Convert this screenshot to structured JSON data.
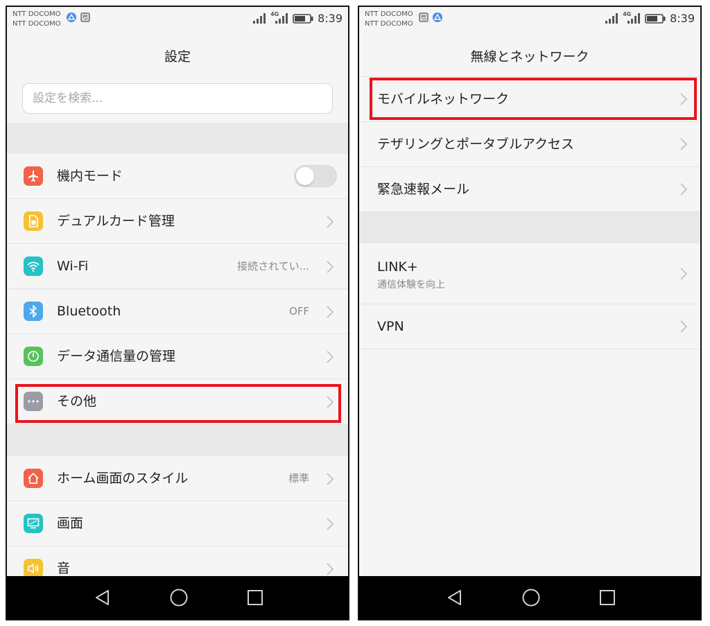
{
  "status_bar": {
    "carrier_line1": "NTT DOCOMO",
    "carrier_line2": "NTT DOCOMO",
    "network": "4G",
    "time": "8:39"
  },
  "left": {
    "title": "設定",
    "search": {
      "placeholder": "設定を検索..."
    },
    "items": [
      {
        "label": "機内モード",
        "icon": "airplane-icon",
        "color": "#f0624a",
        "toggle": "off"
      },
      {
        "label": "デュアルカード管理",
        "icon": "sim-card-icon",
        "color": "#f7c232"
      },
      {
        "label": "Wi-Fi",
        "icon": "wifi-icon",
        "color": "#25c3c4",
        "value": "接続されてい..."
      },
      {
        "label": "Bluetooth",
        "icon": "bluetooth-icon",
        "color": "#4da8ec",
        "value": "OFF"
      },
      {
        "label": "データ通信量の管理",
        "icon": "data-usage-icon",
        "color": "#58c35c"
      },
      {
        "label": "その他",
        "icon": "more-icon",
        "color": "#9a9ca6"
      },
      {
        "label": "ホーム画面のスタイル",
        "icon": "home-icon",
        "color": "#f0624a",
        "value": "標準"
      },
      {
        "label": "画面",
        "icon": "display-icon",
        "color": "#25c3c4"
      },
      {
        "label": "音",
        "icon": "sound-icon",
        "color": "#f7c232"
      }
    ]
  },
  "right": {
    "title": "無線とネットワーク",
    "items": [
      {
        "label": "モバイルネットワーク"
      },
      {
        "label": "テザリングとポータブルアクセス"
      },
      {
        "label": "緊急速報メール"
      },
      {
        "label": "LINK+",
        "sublabel": "通信体験を向上"
      },
      {
        "label": "VPN"
      }
    ]
  },
  "colors": {
    "highlight": "#e8141c",
    "background": "#f5f5f5",
    "navbar": "#000000"
  }
}
